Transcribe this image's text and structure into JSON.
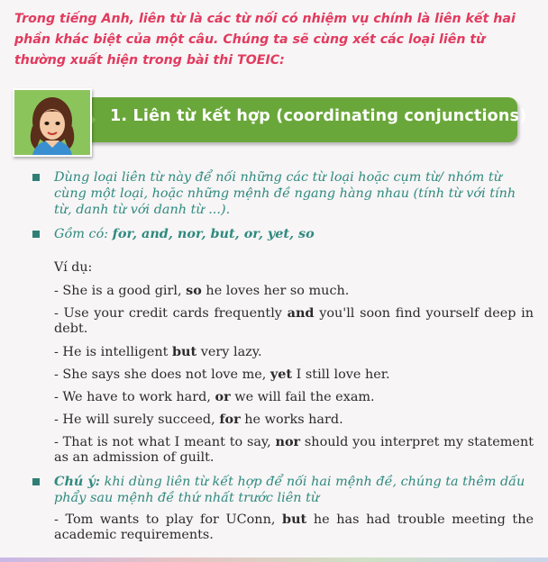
{
  "intro": "Trong tiếng Anh, liên từ là các từ nối có nhiệm vụ chính là liên kết hai phần khác biệt của một câu. Chúng ta sẽ cùng xét các loại liên từ thường xuất hiện trong bài thi TOEIC:",
  "section": {
    "title": "1. Liên từ kết hợp (coordinating conjunctions)"
  },
  "bullets": {
    "first": "Dùng loại liên từ này để nối những các từ loại hoặc cụm từ/ nhóm từ cùng một loại, hoặc những mệnh đề ngang hàng nhau (tính từ với tính từ, danh từ với danh từ ...).",
    "second_label": "Gồm có: ",
    "second_items": "for, and, nor, but, or, yet, so"
  },
  "example_label": "Ví dụ:",
  "examples": [
    {
      "pre": "- She is a good girl, ",
      "bold": "so",
      "post": " he loves her so much."
    },
    {
      "pre": "- Use your credit cards frequently ",
      "bold": "and",
      "post": " you'll soon find yourself deep in debt."
    },
    {
      "pre": "- He is intelligent ",
      "bold": "but",
      "post": " very lazy."
    },
    {
      "pre": "- She says she does not love me, ",
      "bold": "yet",
      "post": " I still love her."
    },
    {
      "pre": "- We have to work hard, ",
      "bold": "or",
      "post": " we will fail the exam."
    },
    {
      "pre": "- He will surely succeed, ",
      "bold": "for",
      "post": " he works hard."
    },
    {
      "pre": "- That is not what I meant to say, ",
      "bold": "nor",
      "post": " should you interpret my statement as an admission of guilt."
    }
  ],
  "note": {
    "label": "Chú ý:",
    "text": " khi dùng liên từ kết hợp để nối hai mệnh đề, chúng ta thêm dấu phẩy sau mệnh đề thứ nhất trước liên từ"
  },
  "final_example": {
    "pre": "- Tom wants to play for UConn, ",
    "bold": "but",
    "post": " he has had trouble meeting the academic requirements."
  },
  "colors": {
    "intro": "#e23a5e",
    "banner": "#6aa73a",
    "teal": "#2f8a7f"
  }
}
